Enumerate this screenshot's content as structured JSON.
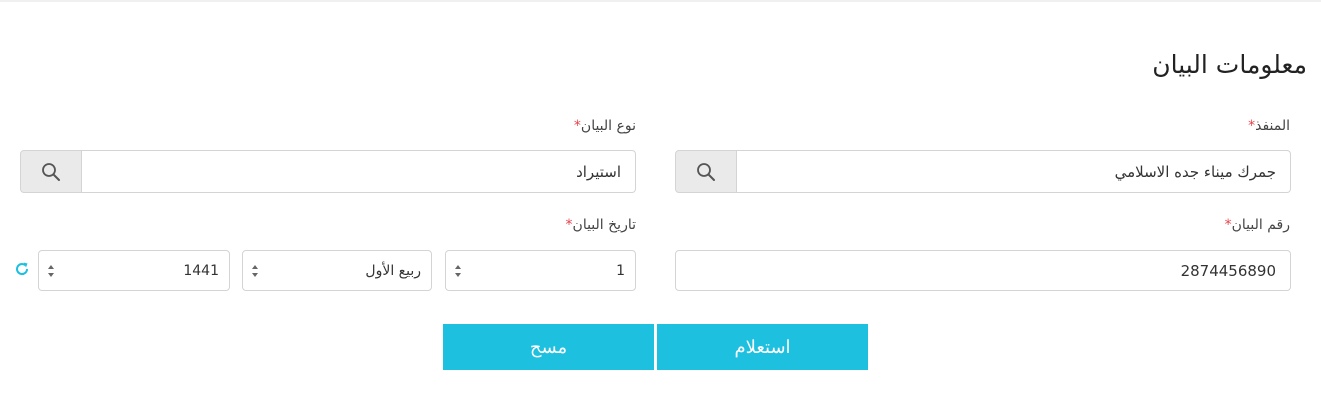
{
  "section": {
    "title": "معلومات البيان"
  },
  "port": {
    "label": "المنفذ",
    "value": "جمرك ميناء جده الاسلامي",
    "icon": "search-icon"
  },
  "declaration_type": {
    "label": "نوع البيان",
    "value": "استيراد",
    "icon": "search-icon"
  },
  "declaration_number": {
    "label": "رقم البيان",
    "value": "2874456890"
  },
  "declaration_date": {
    "label": "تاريخ البيان",
    "day": "1",
    "month": "ربيع الأول",
    "year": "1441",
    "refresh_icon": "refresh-icon"
  },
  "required_marker": "*",
  "actions": {
    "query_label": "استعلام",
    "clear_label": "مسح"
  },
  "colors": {
    "accent": "#1ec0e0",
    "required": "#e8424a",
    "search_button_bg": "#eaeaea"
  }
}
